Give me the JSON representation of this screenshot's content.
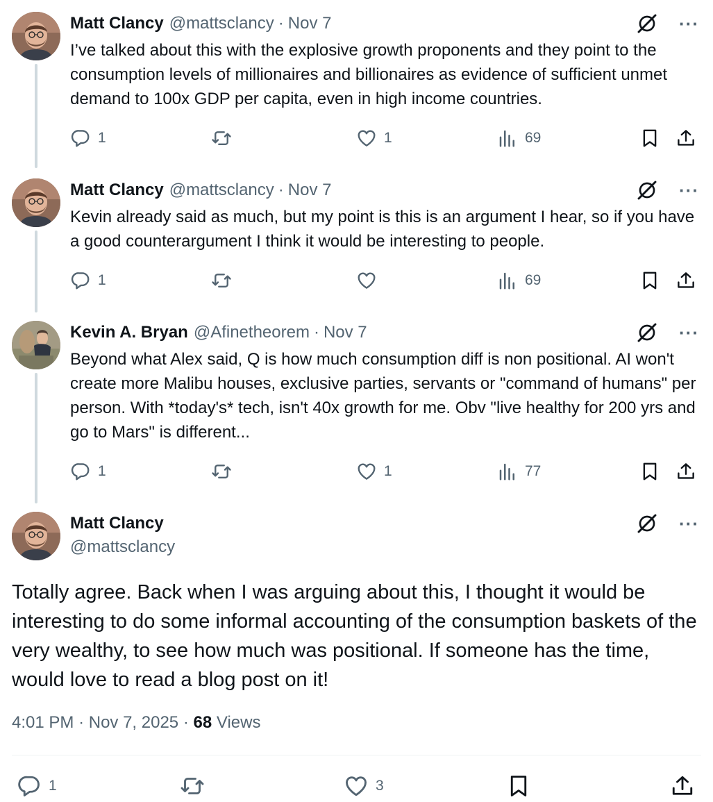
{
  "thread": [
    {
      "name": "Matt Clancy",
      "handle": "@mattsclancy",
      "separator": "·",
      "date": "Nov 7",
      "text": "I’ve talked about this with the explosive growth proponents and they point to the consumption levels of millionaires and billionaires as evidence of sufficient unmet demand to 100x GDP per capita, even in high income countries.",
      "replies": "1",
      "reposts": "",
      "likes": "1",
      "views": "69"
    },
    {
      "name": "Matt Clancy",
      "handle": "@mattsclancy",
      "separator": "·",
      "date": "Nov 7",
      "text": "Kevin already said as much, but my point is this is an argument I hear, so if you have a good counterargument I think it would be interesting to people.",
      "replies": "1",
      "reposts": "",
      "likes": "",
      "views": "69"
    },
    {
      "name": "Kevin A. Bryan",
      "handle": "@Afinetheorem",
      "separator": "·",
      "date": "Nov 7",
      "text": "Beyond what Alex said, Q is how much consumption diff is non positional. AI won't create more Malibu houses, exclusive parties, servants or \"command of humans\" per person. With *today's* tech, isn't 40x growth for me. Obv \"live healthy for 200 yrs and go to Mars\" is different...",
      "replies": "1",
      "reposts": "",
      "likes": "1",
      "views": "77"
    }
  ],
  "main": {
    "name": "Matt Clancy",
    "handle": "@mattsclancy",
    "text": "Totally agree. Back when I was arguing about this, I thought it would be interesting to do some informal accounting of the consumption baskets of the very wealthy, to see how much was positional. If someone has the time, would love to read a blog post on it!",
    "time": "4:01 PM",
    "separator": "·",
    "date": "Nov 7, 2025",
    "views_count": "68",
    "views_label": "Views",
    "replies": "1",
    "reposts": "",
    "likes": "3"
  },
  "icons": {
    "grok": "grok-icon",
    "more": "more-icon",
    "more_glyph": "···",
    "reply": "reply-icon",
    "repost": "repost-icon",
    "like": "heart-icon",
    "views": "views-icon",
    "bookmark": "bookmark-icon",
    "share": "share-icon"
  },
  "colors": {
    "text": "#0f1419",
    "secondary": "#536471",
    "thread_line": "#cfd9de"
  }
}
